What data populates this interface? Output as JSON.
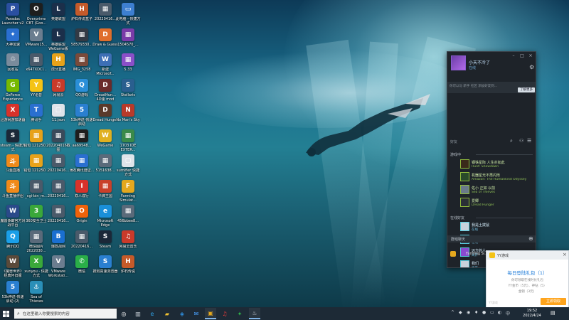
{
  "desktop": {
    "icons": [
      {
        "label": "Paradox Launcher v2",
        "color": "#2a4fa0",
        "glyph": "P"
      },
      {
        "label": "Overprime CBT (Goo...",
        "color": "#1e1e1e",
        "glyph": "O"
      },
      {
        "label": "英雄联盟",
        "color": "#1b2f4a",
        "glyph": "L"
      },
      {
        "label": "炉石传说盒子",
        "color": "#c45a2a",
        "glyph": "H"
      },
      {
        "label": "20220416...",
        "color": "#4a5a6a",
        "glyph": "▦"
      },
      {
        "label": "此电脑 - 快捷方式",
        "color": "#3d7fd0",
        "glyph": "▭"
      },
      {
        "label": "大神加速",
        "color": "#2a6fd0",
        "glyph": "✦"
      },
      {
        "label": "VMware15...",
        "color": "#6b7d8f",
        "glyph": "V"
      },
      {
        "label": "英雄联盟 WeGame版",
        "color": "#1b2f4a",
        "glyph": "L"
      },
      {
        "label": "58579330...",
        "color": "#333a44",
        "glyph": "▦"
      },
      {
        "label": "Draw & Guess",
        "color": "#e06e2c",
        "glyph": "D"
      },
      {
        "label": "1504570_...",
        "color": "#7a3ca8",
        "glyph": "▦"
      },
      {
        "label": "回收站",
        "color": "#7a8b9c",
        "glyph": "♲"
      },
      {
        "label": "x64TXDCI...",
        "color": "#4a5a6a",
        "glyph": "▦"
      },
      {
        "label": "虎牙直播",
        "color": "#e7a21a",
        "glyph": "H"
      },
      {
        "label": "IMG_3258",
        "color": "#7a4a3a",
        "glyph": "▦"
      },
      {
        "label": "新建 Microsof...",
        "color": "#3d6fb5",
        "glyph": "W"
      },
      {
        "label": "5.33",
        "color": "#8a4fc8",
        "glyph": "▦"
      },
      {
        "label": "GeForce Experience",
        "color": "#76b900",
        "glyph": "G"
      },
      {
        "label": "YY语音",
        "color": "#f4c316",
        "glyph": "Y"
      },
      {
        "label": "网易云",
        "color": "#c93a2a",
        "glyph": "♫"
      },
      {
        "label": "QQ游戏",
        "color": "#2a8fd8",
        "glyph": "Q"
      },
      {
        "label": "DreadHun... 4D速 mod",
        "color": "#6a2a2a",
        "glyph": "D"
      },
      {
        "label": "Stellaris",
        "color": "#2a5f8f",
        "glyph": "S"
      },
      {
        "label": "迅游网游加速器",
        "color": "#d8322a",
        "glyph": "X"
      },
      {
        "label": "腾讯手",
        "color": "#2a6fd0",
        "glyph": "T"
      },
      {
        "label": "11.json",
        "color": "#dfe4ea",
        "glyph": "▢"
      },
      {
        "label": "53k伸送-快速启动",
        "color": "#2a7fd0",
        "glyph": "5"
      },
      {
        "label": "Dread Hunger",
        "color": "#5a3a2a",
        "glyph": "D"
      },
      {
        "label": "No Man's Sky",
        "color": "#b83a2a",
        "glyph": "N"
      },
      {
        "label": "steam - 快捷方式",
        "color": "#1b2838",
        "glyph": "S"
      },
      {
        "label": "钱包 121250...",
        "color": "#e7a21a",
        "glyph": "▦"
      },
      {
        "label": "202204016截图",
        "color": "#3a4a5a",
        "glyph": "▦"
      },
      {
        "label": "aa69548...",
        "color": "#1e1e1e",
        "glyph": "▦"
      },
      {
        "label": "WeGame",
        "color": "#e0b020",
        "glyph": "W"
      },
      {
        "label": "1703 IDE EXTER...",
        "color": "#3a8a4a",
        "glyph": "▦"
      },
      {
        "label": "斗鱼直播",
        "color": "#f08a1a",
        "glyph": "斗"
      },
      {
        "label": "钱包 121250...",
        "color": "#e7a21a",
        "glyph": "▦"
      },
      {
        "label": "20220416...",
        "color": "#4a5a6a",
        "glyph": "▦"
      },
      {
        "label": "薄石腾讯谱证...",
        "color": "#2a6fd0",
        "glyph": "▦"
      },
      {
        "label": "5151638...",
        "color": "#5a6a7a",
        "glyph": "▦"
      },
      {
        "label": "sumifier 快捷方式",
        "color": "#dfe4ea",
        "glyph": "▢"
      },
      {
        "label": "斗鱼直播伴侣",
        "color": "#f08a1a",
        "glyph": "斗"
      },
      {
        "label": "_cgi-bin_m...",
        "color": "#4a5a6a",
        "glyph": "▦"
      },
      {
        "label": "20220416...",
        "color": "#4a5a6a",
        "glyph": "▦"
      },
      {
        "label": "双人成行",
        "color": "#d8322a",
        "glyph": "I"
      },
      {
        "label": "卡牌王国",
        "color": "#c9402a",
        "glyph": "▦"
      },
      {
        "label": "Farming Simulat...",
        "color": "#e4a81e",
        "glyph": "F"
      },
      {
        "label": "魔兽争霸官方对战平台",
        "color": "#2a4a8a",
        "glyph": "W"
      },
      {
        "label": "360安全卫士",
        "color": "#3aa83a",
        "glyph": "3"
      },
      {
        "label": "20220416...",
        "color": "#4a5a6a",
        "glyph": "▦"
      },
      {
        "label": "Origin",
        "color": "#f0620a",
        "glyph": "O"
      },
      {
        "label": "Microsoft Edge",
        "color": "#1a8fd8",
        "glyph": "e"
      },
      {
        "label": "456bbee8...",
        "color": "#5a6a7a",
        "glyph": "▦"
      },
      {
        "label": "腾讯QQ",
        "color": "#1a9fe8",
        "glyph": "Q"
      },
      {
        "label": "微信图片 2022030...",
        "color": "#5a6a7a",
        "glyph": "▦"
      },
      {
        "label": "爆款战网",
        "color": "#1a6fd0",
        "glyph": "B"
      },
      {
        "label": "20220416...",
        "color": "#4a5a6a",
        "glyph": "▦"
      },
      {
        "label": "Steam",
        "color": "#1b2838",
        "glyph": "S"
      },
      {
        "label": "网易云音乐",
        "color": "#c93a2a",
        "glyph": "♫"
      },
      {
        "label": "《魔兽世界》 经典怀旧服",
        "color": "#5a4a3a",
        "glyph": "W"
      },
      {
        "label": "xunyou - 快捷方式",
        "color": "#3aa83a",
        "glyph": "X"
      },
      {
        "label": "VMware Workstati...",
        "color": "#6b7d8f",
        "glyph": "V"
      },
      {
        "label": "微信",
        "color": "#2aae48",
        "glyph": "✆"
      },
      {
        "label": "搜狗高速浏览器",
        "color": "#2a7fd0",
        "glyph": "S"
      },
      {
        "label": "炉石传说",
        "color": "#c45a2a",
        "glyph": "H"
      },
      {
        "label": "53k伸送-快速启动 (2)",
        "color": "#2a7fd0",
        "glyph": "5"
      },
      {
        "label": "Sea of Thieves",
        "color": "#2a8fb8",
        "glyph": "⚓"
      }
    ]
  },
  "friends_window": {
    "username": "小天不冷了",
    "status": "在线",
    "notice": "你可以与 新手 社区 添加好友到...",
    "notice_button": "了解更多",
    "search_placeholder": "好友",
    "in_game_section": "游戏中",
    "online_section": "在线好友",
    "in_game": [
      {
        "name": "钢铁星际 人生亦如此",
        "game": "Hunt: Showdown",
        "color": "#3a2a1a"
      },
      {
        "name": "机器星光不再闪烁",
        "game": "Amazon: The Humankind Odyssey",
        "color": "#2a4a2a"
      },
      {
        "name": "佐小 正如 以前",
        "game": "Sea of Thieves",
        "color": "#6a7a8a"
      },
      {
        "name": "爱卿",
        "game": "Dread Hunger",
        "color": "#2a2f36"
      }
    ],
    "online": [
      {
        "name": "我是土拨鼠",
        "game": "在线",
        "color": "#c8d2dc"
      },
      {
        "name": "Sugar&Wine",
        "game": "在线",
        "color": "#3a4a5a"
      },
      {
        "name": "远方的人",
        "game": "离开",
        "color": "#8a4ad0"
      },
      {
        "name": "我们",
        "game": "离开",
        "color": "#c8d2dc"
      },
      {
        "name": "一枝一个小田园梦想",
        "game": "",
        "color": "#6a7a8a"
      }
    ],
    "group_header": "群组聊天",
    "group_name": "Farming Si..."
  },
  "yy_popup": {
    "title": "YY游戏",
    "heading": "每日登陆礼包（1）",
    "line1": "你可领取在线时长礼包",
    "line2": "YY金币（5元）、神钻（5）",
    "line3": "金钥（3元）",
    "button": "立即领取",
    "tag": "YY游戏"
  },
  "taskbar": {
    "search_placeholder": "在这里输入你要搜索的内容",
    "time": "19:52",
    "date": "2022/4/24"
  }
}
